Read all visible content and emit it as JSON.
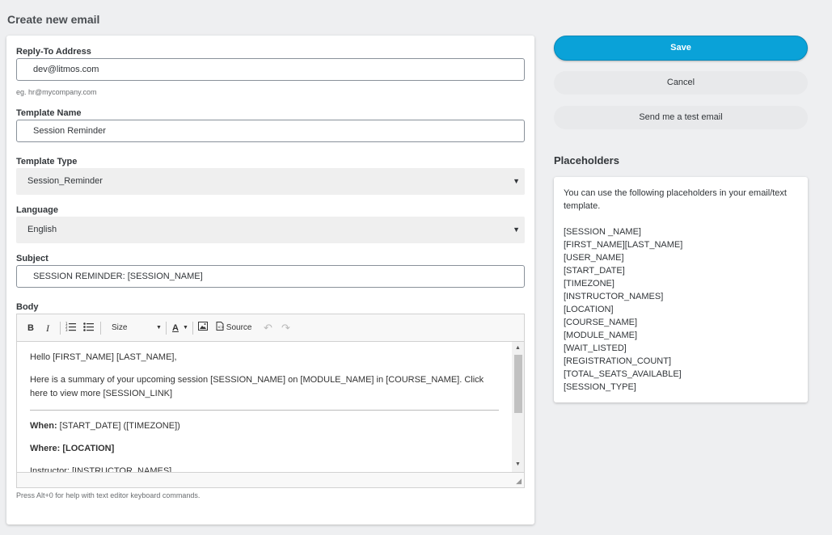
{
  "page": {
    "title": "Create new email"
  },
  "form": {
    "reply_to": {
      "label": "Reply-To Address",
      "value": "dev@litmos.com",
      "hint": "eg. hr@mycompany.com"
    },
    "template_name": {
      "label": "Template Name",
      "value": "Session Reminder"
    },
    "template_type": {
      "label": "Template Type",
      "value": "Session_Reminder"
    },
    "language": {
      "label": "Language",
      "value": "English"
    },
    "subject": {
      "label": "Subject",
      "value": "SESSION REMINDER: [SESSION_NAME]"
    },
    "body": {
      "label": "Body",
      "toolbar": {
        "bold": "B",
        "italic": "I",
        "size_label": "Size",
        "text_color": "A",
        "source_label": "Source"
      },
      "content": {
        "greeting": "Hello [FIRST_NAME] [LAST_NAME],",
        "summary": "Here is a summary of your upcoming session [SESSION_NAME] on [MODULE_NAME] in [COURSE_NAME]. Click here to view more [SESSION_LINK]",
        "when_label": "When:",
        "when_value": " [START_DATE] ([TIMEZONE])",
        "where_label": "Where:",
        "where_value": " [LOCATION]",
        "partial_line": "Instructor: [INSTRUCTOR_NAMES]"
      },
      "help": "Press Alt+0 for help with text editor keyboard commands."
    }
  },
  "actions": {
    "save": "Save",
    "cancel": "Cancel",
    "test_email": "Send me a test email"
  },
  "placeholders": {
    "title": "Placeholders",
    "intro": "You can use the following placeholders in your email/text template.",
    "items": [
      "[SESSION _NAME]",
      "[FIRST_NAME][LAST_NAME]",
      "[USER_NAME]",
      "[START_DATE]",
      "[TIMEZONE]",
      "[INSTRUCTOR_NAMES]",
      "[LOCATION]",
      "[COURSE_NAME]",
      "[MODULE_NAME]",
      "[WAIT_LISTED]",
      "[REGISTRATION_COUNT]",
      "[TOTAL_SEATS_AVAILABLE]",
      "[SESSION_TYPE]"
    ]
  },
  "icons": {
    "numbered_list": "numbered-list-icon",
    "bulleted_list": "bulleted-list-icon",
    "image": "image-icon",
    "undo": "undo-icon",
    "redo": "redo-icon",
    "dropdown": "chevron-down-icon"
  }
}
